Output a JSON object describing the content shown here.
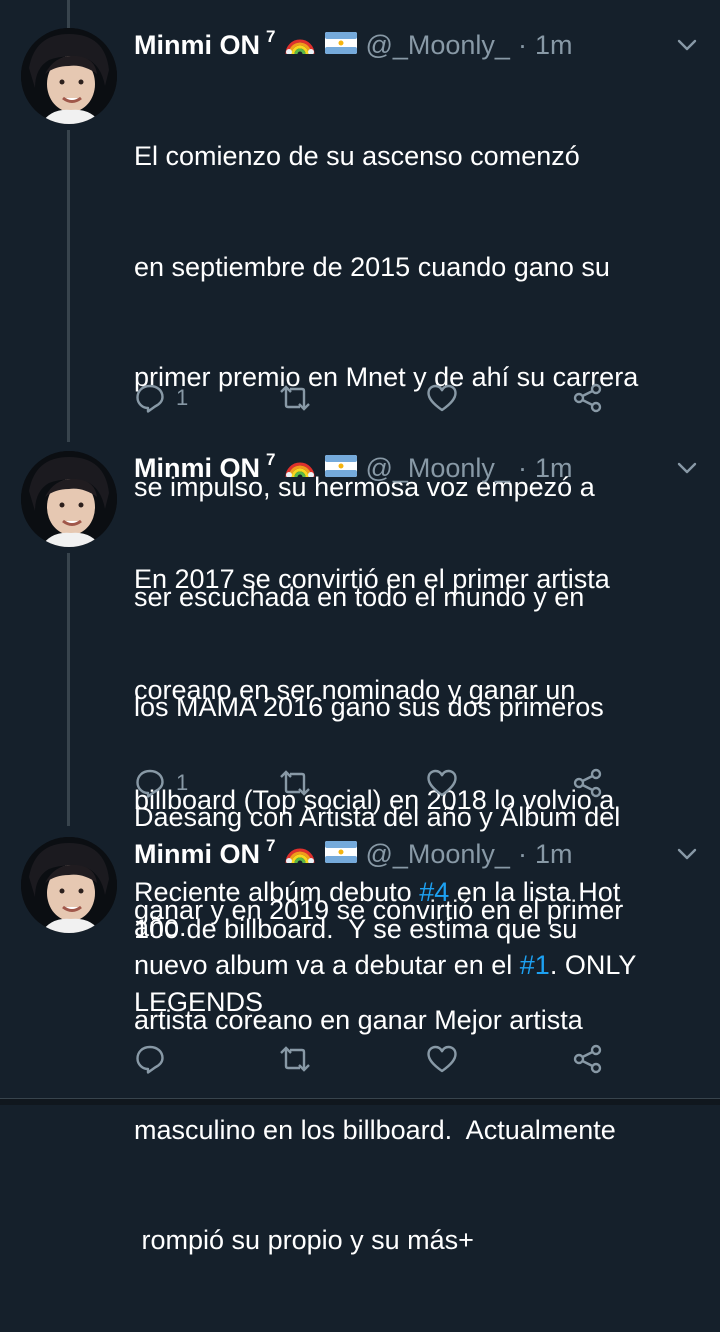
{
  "colors": {
    "background": "#15202b",
    "text": "#ffffff",
    "muted": "#8899a6",
    "link": "#1da1f2",
    "thread_line": "#38444d"
  },
  "tweets": [
    {
      "name": "Minmi ON",
      "superscript": "7",
      "emojis": [
        "rainbow-emoji",
        "argentina-flag-emoji"
      ],
      "handle": "@_Moonly_",
      "separator": "·",
      "time": "1m",
      "lines": [
        "El comienzo de su ascenso comenzó",
        "en septiembre de 2015 cuando gano su",
        "primer premio en Mnet y de ahí su carrera",
        "se impulso, su hermosa voz empezó a",
        "ser escuchada en todo el mundo y en",
        "los MAMA 2016 gano sus dos primeros",
        "Daesang con Artista del año y Álbum del",
        "año."
      ],
      "reply_count": "1"
    },
    {
      "name": "Minmi ON",
      "superscript": "7",
      "emojis": [
        "rainbow-emoji",
        "argentina-flag-emoji"
      ],
      "handle": "@_Moonly_",
      "separator": "·",
      "time": "1m",
      "lines": [
        "En 2017 se convirtió en el primer artista",
        "coreano en ser nominado y ganar un",
        "billboard (Top social) en 2018 lo volvio a",
        "ganar y en 2019 se convirtió en el primer",
        "artista coreano en ganar Mejor artista",
        "masculino en los billboard.  Actualmente",
        " rompió su propio y su más+"
      ],
      "reply_count": "1"
    },
    {
      "name": "Minmi ON",
      "superscript": "7",
      "emojis": [
        "rainbow-emoji",
        "argentina-flag-emoji"
      ],
      "handle": "@_Moonly_",
      "separator": "·",
      "time": "1m",
      "segments": [
        {
          "text": "Reciente albúm debuto ",
          "type": "text"
        },
        {
          "text": "#4",
          "type": "hashtag"
        },
        {
          "text": " en la lista Hot\n100 de billboard.  Y se estima que su\nnuevo album va a debutar en el ",
          "type": "text"
        },
        {
          "text": "#1",
          "type": "hashtag"
        },
        {
          "text": ". ONLY\nLEGENDS",
          "type": "text"
        }
      ],
      "reply_count": ""
    }
  ]
}
